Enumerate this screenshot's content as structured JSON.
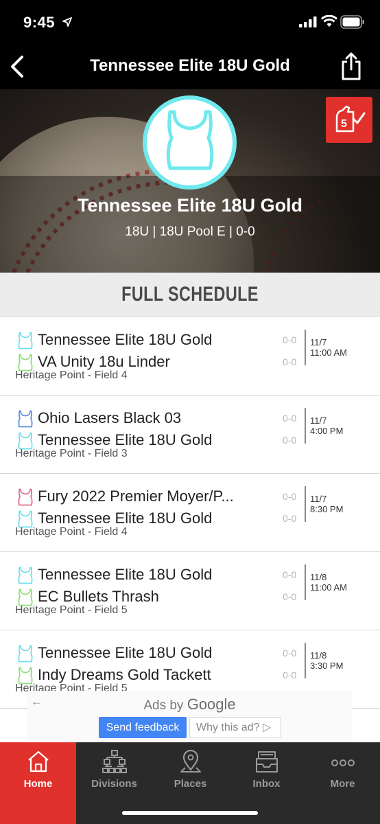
{
  "status_bar": {
    "time": "9:45"
  },
  "nav": {
    "title": "Tennessee Elite 18U Gold"
  },
  "hero": {
    "team_name": "Tennessee Elite 18U Gold",
    "subtitle": "18U | 18U Pool E | 0-0",
    "badge_count": "5",
    "logo_color": "#6fe9ee",
    "badge_color": "#e0312c"
  },
  "section": {
    "title": "FULL SCHEDULE"
  },
  "games": [
    {
      "team1": {
        "name": "Tennessee Elite 18U Gold",
        "jersey_color": "#6fe0ec",
        "score": "0-0"
      },
      "team2": {
        "name": "VA Unity 18u Linder",
        "jersey_color": "#8ee07a",
        "score": "0-0"
      },
      "date": "11/7",
      "time": "11:00 AM",
      "location": "Heritage Point - Field 4"
    },
    {
      "team1": {
        "name": "Ohio Lasers Black 03",
        "jersey_color": "#5b8fe0",
        "score": "0-0"
      },
      "team2": {
        "name": "Tennessee Elite 18U Gold",
        "jersey_color": "#6fe0ec",
        "score": "0-0"
      },
      "date": "11/7",
      "time": "4:00 PM",
      "location": "Heritage Point - Field 3"
    },
    {
      "team1": {
        "name": "Fury 2022 Premier Moyer/P...",
        "jersey_color": "#e86a8e",
        "score": "0-0"
      },
      "team2": {
        "name": "Tennessee Elite 18U Gold",
        "jersey_color": "#6fe0ec",
        "score": "0-0"
      },
      "date": "11/7",
      "time": "8:30 PM",
      "location": "Heritage Point - Field 4"
    },
    {
      "team1": {
        "name": "Tennessee Elite 18U Gold",
        "jersey_color": "#6fe0ec",
        "score": "0-0"
      },
      "team2": {
        "name": "EC Bullets Thrash",
        "jersey_color": "#8ee07a",
        "score": "0-0"
      },
      "date": "11/8",
      "time": "11:00 AM",
      "location": "Heritage Point - Field 5"
    },
    {
      "team1": {
        "name": "Tennessee Elite 18U Gold",
        "jersey_color": "#6fe0ec",
        "score": "0-0"
      },
      "team2": {
        "name": "Indy Dreams Gold Tackett",
        "jersey_color": "#8ee07a",
        "score": "0-0"
      },
      "date": "11/8",
      "time": "3:30 PM",
      "location": "Heritage Point - Field 5"
    }
  ],
  "ad": {
    "ads_by": "Ads by",
    "google": "Google",
    "feedback_label": "Send feedback",
    "why_label": "Why this ad?"
  },
  "tabs": [
    {
      "label": "Home",
      "icon": "home-icon",
      "active": true
    },
    {
      "label": "Divisions",
      "icon": "bracket-icon",
      "active": false
    },
    {
      "label": "Places",
      "icon": "map-pin-icon",
      "active": false
    },
    {
      "label": "Inbox",
      "icon": "inbox-icon",
      "active": false
    },
    {
      "label": "More",
      "icon": "more-dots-icon",
      "active": false
    }
  ],
  "colors": {
    "accent": "#e0312c",
    "tab_bg": "#2a2a2a",
    "header_bg": "#000000"
  }
}
